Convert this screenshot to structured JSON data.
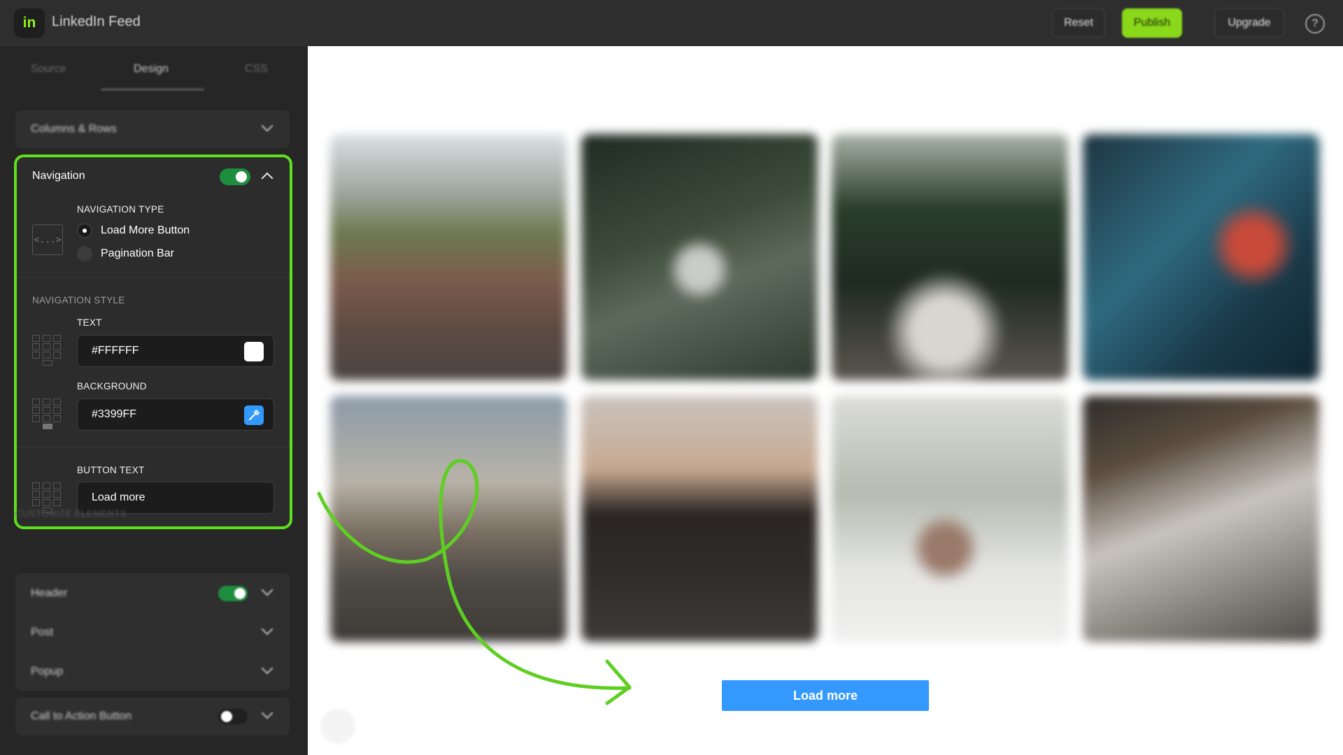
{
  "header": {
    "logo_text": "in",
    "app_title": "LinkedIn Feed",
    "reset_label": "Reset",
    "publish_label": "Publish",
    "upgrade_label": "Upgrade",
    "help_symbol": "?"
  },
  "sidebar": {
    "tabs": [
      {
        "label": "Source"
      },
      {
        "label": "Design",
        "active": true
      },
      {
        "label": "CSS"
      }
    ],
    "columns_rows_label": "Columns & Rows",
    "navigation": {
      "title": "Navigation",
      "enabled": true,
      "type_caption": "NAVIGATION TYPE",
      "type_icon_text": "<...>",
      "options": [
        {
          "label": "Load More Button",
          "selected": true
        },
        {
          "label": "Pagination Bar",
          "selected": false
        }
      ],
      "style_caption": "NAVIGATION STYLE",
      "text_caption": "TEXT",
      "text_color": "#FFFFFF",
      "background_caption": "BACKGROUND",
      "background_color": "#3399FF",
      "button_text_caption": "BUTTON TEXT",
      "button_text": "Load more"
    },
    "customize_caption": "CUSTOMIZE ELEMENTS",
    "elements": [
      {
        "label": "Header",
        "enabled": true
      },
      {
        "label": "Post"
      },
      {
        "label": "Popup"
      }
    ],
    "cta": {
      "label": "Call to Action Button",
      "enabled": false
    }
  },
  "main": {
    "photos": [
      {
        "subject": "townhouses"
      },
      {
        "subject": "waterfall"
      },
      {
        "subject": "car-forest-road"
      },
      {
        "subject": "neon-street"
      },
      {
        "subject": "sea-shore"
      },
      {
        "subject": "desert-road"
      },
      {
        "subject": "snow-monkey"
      },
      {
        "subject": "train-station"
      }
    ],
    "load_more_label": "Load more"
  },
  "colors": {
    "accent_green": "#5EE01E",
    "publish_green": "#8AD81A",
    "button_blue": "#3399FF",
    "toggle_on": "#1E8E3E"
  }
}
